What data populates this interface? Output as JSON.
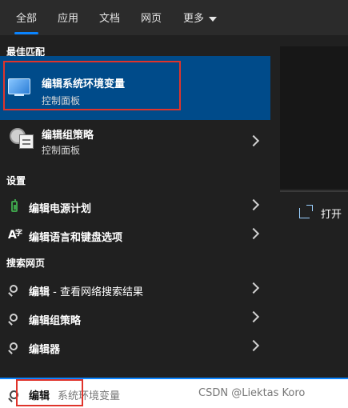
{
  "tabs": [
    "全部",
    "应用",
    "文档",
    "网页",
    "更多"
  ],
  "best_match": {
    "section": "最佳匹配",
    "title": "编辑系统环境变量",
    "subtitle": "控制面板"
  },
  "apps": [
    {
      "title": "编辑组策略",
      "subtitle": "控制面板"
    }
  ],
  "settings": {
    "section": "设置",
    "items": [
      {
        "title": "编辑电源计划"
      },
      {
        "title": "编辑语言和键盘选项"
      }
    ]
  },
  "web": {
    "section": "搜索网页",
    "items": [
      {
        "title": "编辑",
        "suffix": " - 查看网络搜索结果"
      },
      {
        "title": "编辑组策略"
      },
      {
        "title": "编辑器"
      }
    ]
  },
  "right_panel": {
    "open_label": "打开"
  },
  "search": {
    "typed": "编辑",
    "suggestion": "系统环境变量"
  },
  "watermark": "CSDN @Liektas Koro"
}
